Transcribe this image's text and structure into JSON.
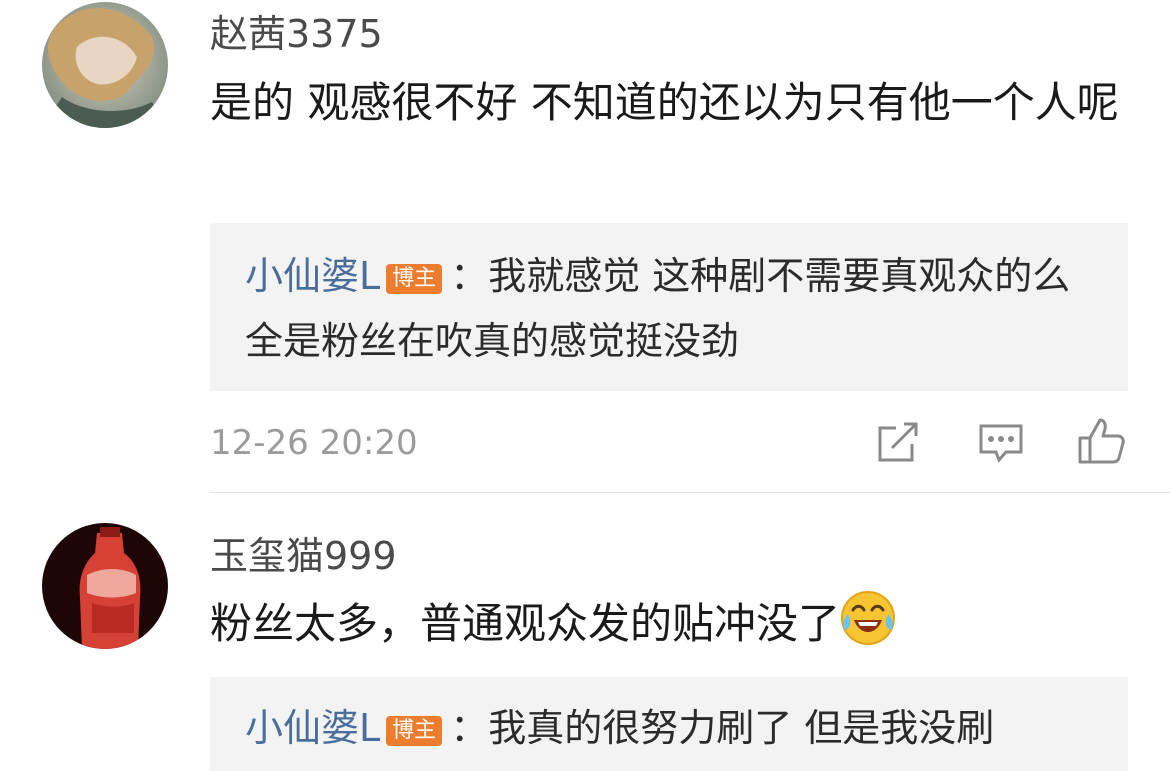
{
  "comments": [
    {
      "username": "赵茜3375",
      "text": "是的 观感很不好  不知道的还以为只有他一个人呢",
      "reply": {
        "author": "小仙婆L",
        "badge": "博主",
        "separator": "：",
        "text": "我就感觉 这种剧不需要真观众的么 全是粉丝在吹真的感觉挺没劲"
      },
      "timestamp": "12-26 20:20"
    },
    {
      "username": "玉玺猫999",
      "text": "粉丝太多，普通观众发的贴冲没了",
      "emoji": "laughing-crying-emoji",
      "reply": {
        "author": "小仙婆L",
        "badge": "博主",
        "separator": "：",
        "text": "我真的很努力刷了 但是我没刷"
      }
    }
  ],
  "actions": [
    "share-icon",
    "comment-icon",
    "like-icon"
  ],
  "colors": {
    "reply_author": "#4a6e9c",
    "badge": "#ee7c2e",
    "reply_background": "#f3f3f3",
    "timestamp": "#9b9b9b"
  }
}
